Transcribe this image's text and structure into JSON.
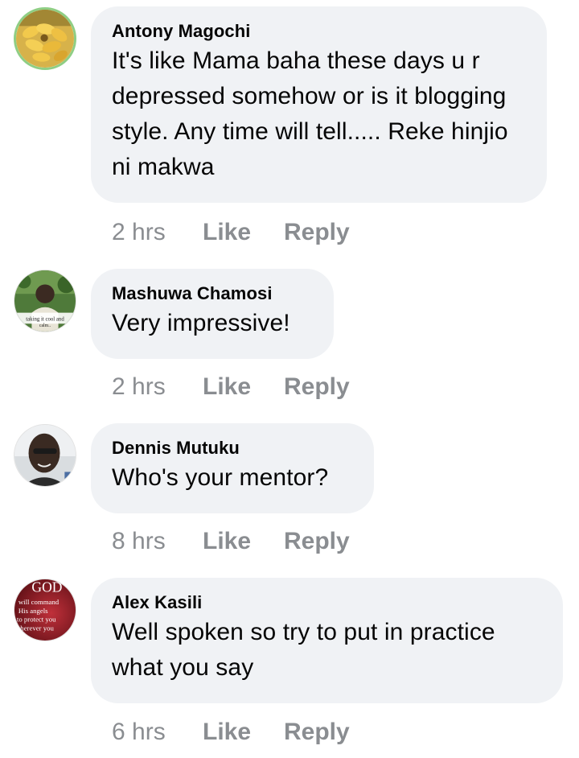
{
  "comments": [
    {
      "author": "Antony Magochi",
      "text": "It's like Mama baha these days u r depressed somehow or is it blogging style. Any time will tell..... Reke hinjio ni makwa",
      "time": "2 hrs",
      "like_label": "Like",
      "reply_label": "Reply",
      "avatar_icon": "bananas-avatar"
    },
    {
      "author": "Mashuwa Chamosi",
      "text": "Very impressive!",
      "time": "2 hrs",
      "like_label": "Like",
      "reply_label": "Reply",
      "avatar_icon": "person-photo-avatar",
      "avatar_caption": "taking it cool and calm.."
    },
    {
      "author": "Dennis Mutuku",
      "text": "Who's your mentor?",
      "time": "8 hrs",
      "like_label": "Like",
      "reply_label": "Reply",
      "avatar_icon": "person-photo-avatar"
    },
    {
      "author": "Alex Kasili",
      "text": "Well spoken so try to put in practice what you say",
      "time": "6 hrs",
      "like_label": "Like",
      "reply_label": "Reply",
      "avatar_icon": "scripture-text-avatar",
      "avatar_caption_lines": [
        "GOD",
        "will command",
        "His angels",
        "to protect you",
        "wherever you"
      ]
    }
  ],
  "colors": {
    "bubble_bg": "#f0f2f5",
    "text": "#050505",
    "meta": "#8a8d91"
  }
}
